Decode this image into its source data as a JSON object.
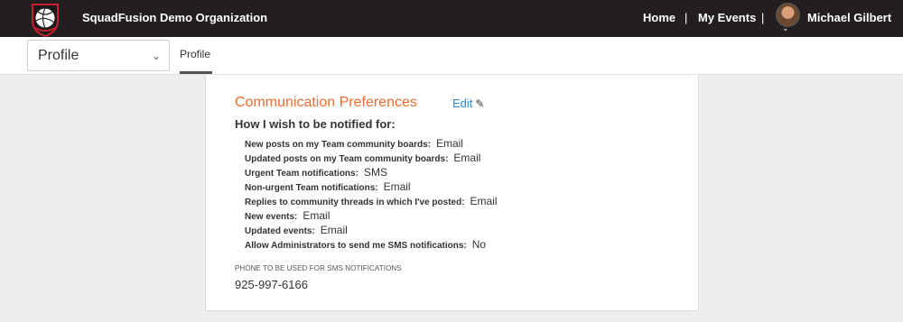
{
  "header": {
    "org_name": "SquadFusion Demo Organization",
    "nav_home": "Home",
    "separator": "|",
    "nav_my_events": "My Events",
    "user_name": "Michael Gilbert"
  },
  "subnav": {
    "selector_value": "Profile",
    "tab_label": "Profile"
  },
  "communication": {
    "title": "Communication Preferences",
    "edit_label": "Edit",
    "subtitle": "How I wish to be notified for:",
    "preferences": [
      {
        "label": "New posts on my Team community boards:",
        "value": "Email"
      },
      {
        "label": "Updated posts on my Team community boards:",
        "value": "Email"
      },
      {
        "label": "Urgent Team notifications:",
        "value": "SMS"
      },
      {
        "label": "Non-urgent Team notifications:",
        "value": "Email"
      },
      {
        "label": "Replies to community threads in which I've posted:",
        "value": "Email"
      },
      {
        "label": "New events:",
        "value": "Email"
      },
      {
        "label": "Updated events:",
        "value": "Email"
      },
      {
        "label": "Allow Administrators to send me SMS notifications:",
        "value": "No"
      }
    ],
    "phone_label": "PHONE TO BE USED FOR SMS NOTIFICATIONS",
    "phone_value": "925-997-6166"
  },
  "colors": {
    "header_bg": "#231f20",
    "accent_orange": "#f26b2b",
    "link_blue": "#2b8bd6"
  },
  "icons": {
    "logo": "volleyball-logo-icon",
    "edit": "pencil-icon",
    "select_chevron": "chevron-down-icon",
    "avatar_chevron": "chevron-down-icon"
  }
}
